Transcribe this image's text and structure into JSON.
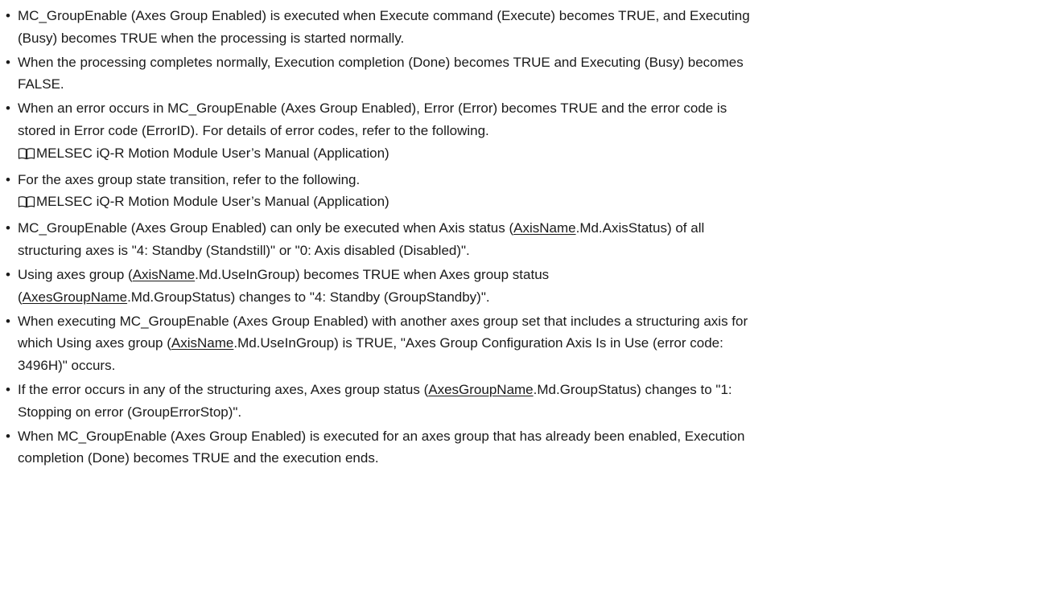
{
  "bullet_char": "•",
  "items": [
    {
      "lines": [
        [
          "MC_GroupEnable (Axes Group Enabled) is executed when Execute command (Execute) becomes TRUE, and Executing"
        ],
        [
          "(Busy) becomes TRUE when the processing is started normally."
        ]
      ]
    },
    {
      "lines": [
        [
          "When the processing completes normally, Execution completion (Done) becomes TRUE and Executing (Busy) becomes"
        ],
        [
          "FALSE."
        ]
      ]
    },
    {
      "lines": [
        [
          "When an error occurs in MC_GroupEnable (Axes Group Enabled), Error (Error) becomes TRUE and the error code is"
        ],
        [
          "stored in Error code (ErrorID). For details of error codes, refer to the following."
        ]
      ],
      "reference": "MELSEC iQ-R Motion Module User’s Manual (Application)"
    },
    {
      "lines": [
        [
          "For the axes group state transition, refer to the following."
        ]
      ],
      "reference": "MELSEC iQ-R Motion Module User’s Manual (Application)"
    },
    {
      "lines": [
        [
          "MC_GroupEnable (Axes Group Enabled) can only be executed when Axis status (",
          "AxisName",
          ".Md.AxisStatus) of all"
        ],
        [
          "structuring axes is \"4: Standby (Standstill)\" or \"0: Axis disabled (Disabled)\"."
        ]
      ]
    },
    {
      "lines": [
        [
          "Using axes group (",
          "AxisName",
          ".Md.UseInGroup) becomes TRUE when Axes group status"
        ],
        [
          "(",
          "AxesGroupName",
          ".Md.GroupStatus) changes to \"4: Standby (GroupStandby)\"."
        ]
      ]
    },
    {
      "lines": [
        [
          "When executing MC_GroupEnable (Axes Group Enabled) with another axes group set that includes a structuring axis for"
        ],
        [
          "which Using axes group (",
          "AxisName",
          ".Md.UseInGroup) is TRUE, \"Axes Group Configuration Axis Is in Use (error code:"
        ],
        [
          "3496H)\" occurs."
        ]
      ]
    },
    {
      "lines": [
        [
          " If the error occurs in any of the structuring axes, Axes group status (",
          "AxesGroupName",
          ".Md.GroupStatus) changes to \"1:"
        ],
        [
          "Stopping on error (GroupErrorStop)\"."
        ]
      ]
    },
    {
      "lines": [
        [
          "When MC_GroupEnable (Axes Group Enabled) is executed for an axes group that has already been enabled, Execution"
        ],
        [
          "completion (Done) becomes TRUE and the execution ends."
        ]
      ]
    }
  ]
}
